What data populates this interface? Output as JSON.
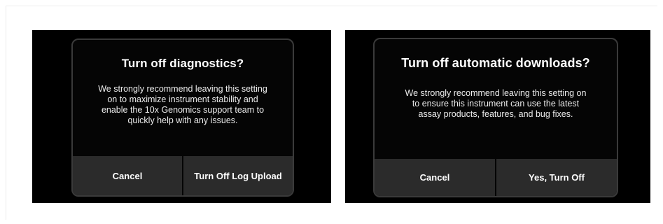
{
  "dialogs": [
    {
      "title": "Turn off diagnostics?",
      "message": "We strongly recommend leaving this setting on to maximize instrument stability and enable the 10x Genomics support team to quickly help with any issues.",
      "cancel_label": "Cancel",
      "confirm_label": "Turn Off Log Upload"
    },
    {
      "title": "Turn off automatic downloads?",
      "message": "We strongly recommend leaving this setting on to ensure this instrument can use the latest assay products, features, and bug fixes.",
      "cancel_label": "Cancel",
      "confirm_label": "Yes, Turn Off"
    }
  ],
  "colors": {
    "screen_background": "#000000",
    "dialog_border": "#3a3a3a",
    "button_background": "#2b2b2b",
    "text": "#ffffff"
  }
}
